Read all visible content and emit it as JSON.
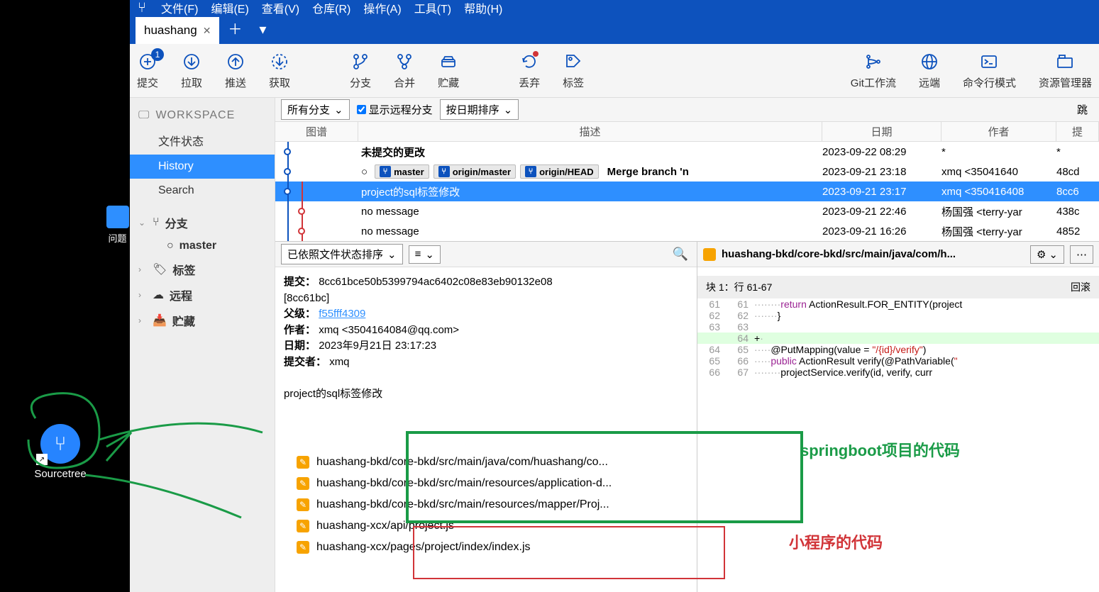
{
  "menu": {
    "file": "文件(F)",
    "edit": "编辑(E)",
    "view": "查看(V)",
    "repo": "仓库(R)",
    "action": "操作(A)",
    "tools": "工具(T)",
    "help": "帮助(H)"
  },
  "tab": {
    "name": "huashang"
  },
  "toolbar": {
    "commit": "提交",
    "commit_badge": "1",
    "pull": "拉取",
    "push": "推送",
    "fetch": "获取",
    "branch": "分支",
    "merge": "合并",
    "stash": "贮藏",
    "discard": "丢弃",
    "tag": "标签",
    "gitflow": "Git工作流",
    "remote": "远端",
    "terminal": "命令行模式",
    "explorer": "资源管理器"
  },
  "sidebar": {
    "workspace": "WORKSPACE",
    "items": {
      "filestatus": "文件状态",
      "history": "History",
      "search": "Search"
    },
    "branches": "分支",
    "master": "master",
    "tags": "标签",
    "remotes": "远程",
    "stashes": "贮藏"
  },
  "filter": {
    "all_branches": "所有分支",
    "show_remote": "显示远程分支",
    "sort_date": "按日期排序",
    "jump": "跳"
  },
  "headers": {
    "graph": "图谱",
    "desc": "描述",
    "date": "日期",
    "author": "作者",
    "commit": "提"
  },
  "commits": [
    {
      "desc": "未提交的更改",
      "date": "2023-09-22 08:29",
      "author": "*",
      "hash": "*",
      "bold": true
    },
    {
      "tags": [
        "master",
        "origin/master",
        "origin/HEAD"
      ],
      "desc": "Merge branch 'n",
      "date": "2023-09-21 23:18",
      "author": "xmq <35041640",
      "hash": "48cd",
      "bold": true
    },
    {
      "desc": "project的sql标签修改",
      "date": "2023-09-21 23:17",
      "author": "xmq <350416408",
      "hash": "8cc6",
      "selected": true
    },
    {
      "desc": "no message",
      "date": "2023-09-21 22:46",
      "author": "杨国强 <terry-yar",
      "hash": "438c"
    },
    {
      "desc": "no message",
      "date": "2023-09-21 16:26",
      "author": "杨国强 <terry-yar",
      "hash": "4852"
    }
  ],
  "detail_sort": "已依照文件状态排序",
  "info": {
    "commit_label": "提交：",
    "commit_hash": "8cc61bce50b5399794ac6402c08e83eb90132e08",
    "commit_short": "[8cc61bc]",
    "parent_label": "父级：",
    "parent_hash": "f55fff4309",
    "author_label": "作者：",
    "author": "xmq <3504164084@qq.com>",
    "date_label": "日期：",
    "date": "2023年9月21日 23:17:23",
    "committer_label": "提交者：",
    "committer": "xmq",
    "message": "project的sql标签修改"
  },
  "files": [
    "huashang-bkd/core-bkd/src/main/java/com/huashang/co...",
    "huashang-bkd/core-bkd/src/main/resources/application-d...",
    "huashang-bkd/core-bkd/src/main/resources/mapper/Proj...",
    "huashang-xcx/api/project.js",
    "huashang-xcx/pages/project/index/index.js"
  ],
  "diff": {
    "path": "huashang-bkd/core-bkd/src/main/java/com/h...",
    "hunk": "块 1：行 61-67",
    "revert": "回滚"
  },
  "annotations": {
    "springboot": "springboot项目的代码",
    "miniprogram": "小程序的代码"
  },
  "desktop": {
    "issue": "问题",
    "sourcetree": "Sourcetree"
  }
}
